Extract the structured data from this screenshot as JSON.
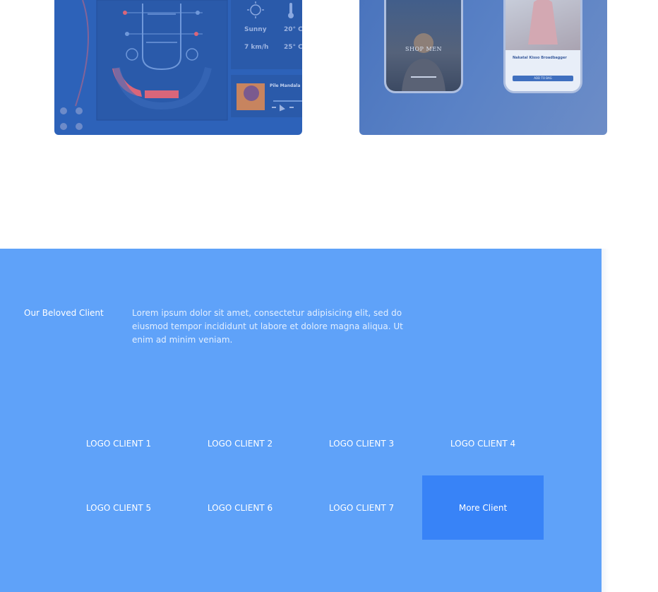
{
  "portfolio": {
    "dashboard_card": {
      "weather": {
        "condition": "Sunny",
        "wind": "7 km/h",
        "temp_high": "20° C",
        "temp_low": "25° C"
      },
      "player_title": "Pile Mandala"
    },
    "mobile_card": {
      "hero_caption": "SHOP MEN",
      "product_title": "Nakatal Kisso Broadbagger",
      "button_label": "ADD TO BAG"
    }
  },
  "clients": {
    "heading": "Our Beloved Client",
    "description": "Lorem ipsum dolor sit amet, consectetur adipisicing elit, sed do eiusmod tempor incididunt ut labore et dolore magna aliqua. Ut enim ad minim veniam.",
    "logos": [
      "LOGO CLIENT 1",
      "LOGO CLIENT 2",
      "LOGO CLIENT 3",
      "LOGO CLIENT 4",
      "LOGO CLIENT 5",
      "LOGO CLIENT 6",
      "LOGO CLIENT 7"
    ],
    "more_label": "More Client"
  },
  "colors": {
    "section_background": "#5fa2f9",
    "more_button": "#3883f7",
    "dashboard_card": "#2d62b9",
    "accent_red": "#d9667a"
  }
}
